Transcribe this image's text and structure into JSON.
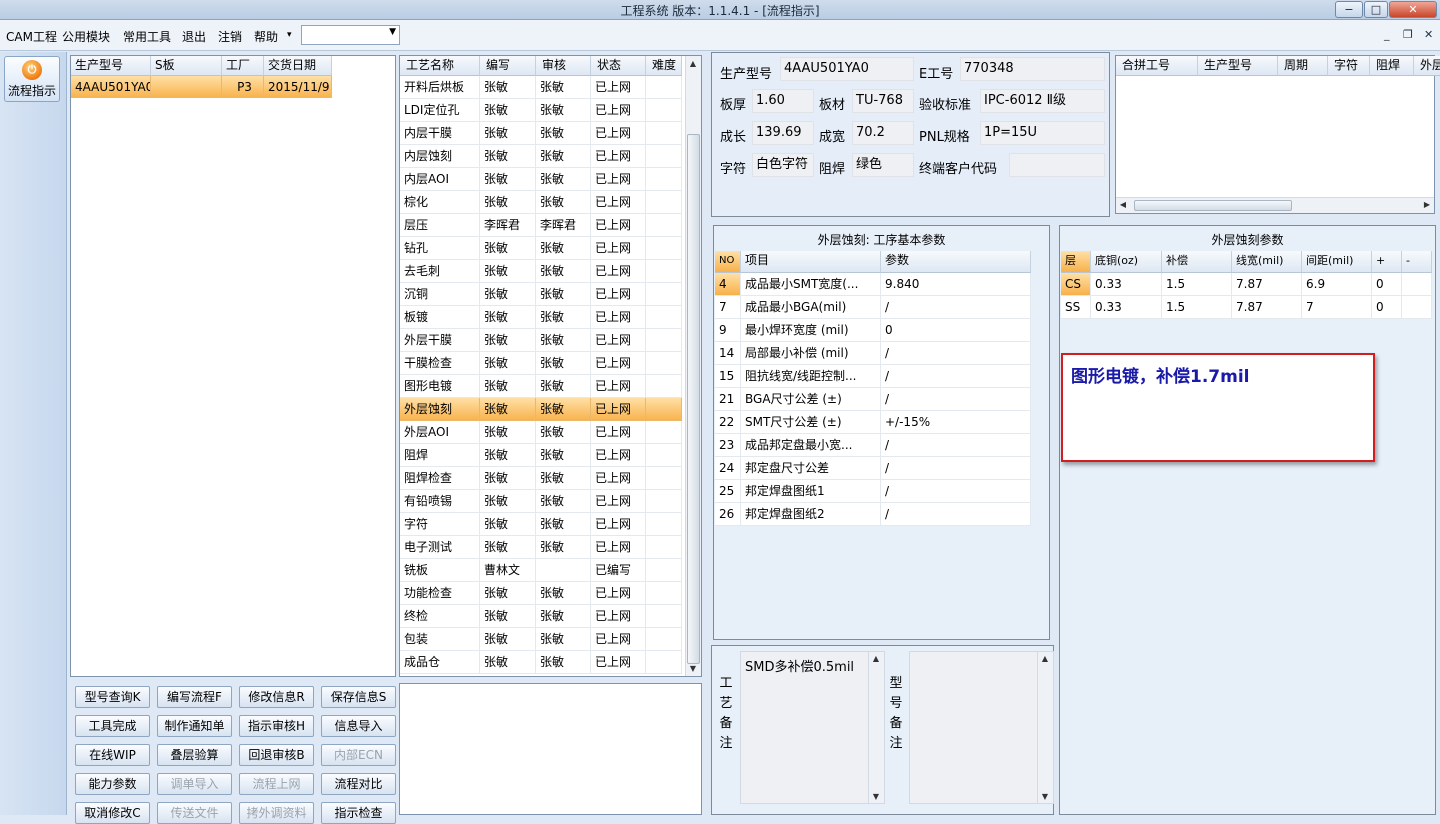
{
  "window": {
    "title": "工程系统   版本：1.1.4.1 - [流程指示]",
    "min": "−",
    "max": "□",
    "close": "✕"
  },
  "menu": {
    "items": [
      "CAM工程",
      "公用模块",
      "常用工具",
      "退出",
      "注销",
      "帮助"
    ],
    "help_arrow": "▾",
    "combo_value": "",
    "mdi": [
      "_",
      "❐",
      "✕"
    ]
  },
  "nav": {
    "flow_button": "流程指示"
  },
  "orders": {
    "columns": [
      "生产型号",
      "S板",
      "工厂",
      "交货日期"
    ],
    "rows": [
      [
        "4AAU501YA0",
        "",
        "P3",
        "2015/11/9"
      ]
    ]
  },
  "process": {
    "columns": [
      "工艺名称",
      "编写",
      "审核",
      "状态",
      "难度"
    ],
    "selected_index": 14,
    "rows": [
      [
        "开料后烘板",
        "张敏",
        "张敏",
        "已上网",
        ""
      ],
      [
        "LDI定位孔",
        "张敏",
        "张敏",
        "已上网",
        ""
      ],
      [
        "内层干膜",
        "张敏",
        "张敏",
        "已上网",
        ""
      ],
      [
        "内层蚀刻",
        "张敏",
        "张敏",
        "已上网",
        ""
      ],
      [
        "内层AOI",
        "张敏",
        "张敏",
        "已上网",
        ""
      ],
      [
        "棕化",
        "张敏",
        "张敏",
        "已上网",
        ""
      ],
      [
        "层压",
        "李晖君",
        "李晖君",
        "已上网",
        ""
      ],
      [
        "钻孔",
        "张敏",
        "张敏",
        "已上网",
        ""
      ],
      [
        "去毛刺",
        "张敏",
        "张敏",
        "已上网",
        ""
      ],
      [
        "沉铜",
        "张敏",
        "张敏",
        "已上网",
        ""
      ],
      [
        "板镀",
        "张敏",
        "张敏",
        "已上网",
        ""
      ],
      [
        "外层干膜",
        "张敏",
        "张敏",
        "已上网",
        ""
      ],
      [
        "干膜检查",
        "张敏",
        "张敏",
        "已上网",
        ""
      ],
      [
        "图形电镀",
        "张敏",
        "张敏",
        "已上网",
        ""
      ],
      [
        "外层蚀刻",
        "张敏",
        "张敏",
        "已上网",
        ""
      ],
      [
        "外层AOI",
        "张敏",
        "张敏",
        "已上网",
        ""
      ],
      [
        "阻焊",
        "张敏",
        "张敏",
        "已上网",
        ""
      ],
      [
        "阻焊检查",
        "张敏",
        "张敏",
        "已上网",
        ""
      ],
      [
        "有铅喷锡",
        "张敏",
        "张敏",
        "已上网",
        ""
      ],
      [
        "字符",
        "张敏",
        "张敏",
        "已上网",
        ""
      ],
      [
        "电子测试",
        "张敏",
        "张敏",
        "已上网",
        ""
      ],
      [
        "铣板",
        "曹林文",
        "",
        "已编写",
        ""
      ],
      [
        "功能检查",
        "张敏",
        "张敏",
        "已上网",
        ""
      ],
      [
        "终检",
        "张敏",
        "张敏",
        "已上网",
        ""
      ],
      [
        "包装",
        "张敏",
        "张敏",
        "已上网",
        ""
      ],
      [
        "成品仓",
        "张敏",
        "张敏",
        "已上网",
        ""
      ]
    ]
  },
  "buttons": [
    [
      "型号查询K",
      "编写流程F",
      "修改信息R",
      "保存信息S"
    ],
    [
      "工具完成",
      "制作通知单",
      "指示审核H",
      "信息导入"
    ],
    [
      "在线WIP",
      "叠层验算",
      "回退审核B",
      "内部ECN"
    ],
    [
      "能力参数",
      "调单导入",
      "流程上网",
      "流程对比"
    ],
    [
      "取消修改C",
      "传送文件",
      "拷外调资料",
      "指示检查"
    ]
  ],
  "buttons_disabled": [
    "内部ECN",
    "调单导入",
    "流程上网",
    "传送文件",
    "拷外调资料"
  ],
  "info": {
    "model_label": "生产型号",
    "model": "4AAU501YA0",
    "e_label": "E工号",
    "e_no": "770348",
    "thick_label": "板厚",
    "thick": "1.60",
    "mat_label": "板材",
    "mat": "TU-768",
    "std_label": "验收标准",
    "std": "IPC-6012 Ⅱ级",
    "len_label": "成长",
    "len": "139.69",
    "wid_label": "成宽",
    "wid": "70.2",
    "pnl_label": "PNL规格",
    "pnl": "1P=15U",
    "char_label": "字符",
    "char": "白色字符",
    "mask_label": "阻焊",
    "mask": "绿色",
    "cust_label": "终端客户代码",
    "cust": ""
  },
  "merge": {
    "columns": [
      "合拼工号",
      "生产型号",
      "周期",
      "字符",
      "阻焊",
      "外层"
    ]
  },
  "basic_params": {
    "title": "外层蚀刻: 工序基本参数",
    "columns": [
      "NO",
      "项目",
      "参数"
    ],
    "selected_index": 0,
    "rows": [
      [
        "4",
        "成品最小SMT宽度(...",
        "9.840"
      ],
      [
        "7",
        "成品最小BGA(mil)",
        "/"
      ],
      [
        "9",
        "最小焊环宽度 (mil)",
        "0"
      ],
      [
        "14",
        "局部最小补偿 (mil)",
        "/"
      ],
      [
        "15",
        "阻抗线宽/线距控制...",
        "/"
      ],
      [
        "21",
        "BGA尺寸公差 (±)",
        "/"
      ],
      [
        "22",
        "SMT尺寸公差 (±)",
        "+/-15%"
      ],
      [
        "23",
        "成品邦定盘最小宽...",
        "/"
      ],
      [
        "24",
        "邦定盘尺寸公差",
        "/"
      ],
      [
        "25",
        "邦定焊盘图纸1",
        "/"
      ],
      [
        "26",
        "邦定焊盘图纸2",
        "/"
      ]
    ]
  },
  "etch_params": {
    "title": "外层蚀刻参数",
    "columns": [
      "层",
      "底铜(oz)",
      "补偿",
      "线宽(mil)",
      "间距(mil)",
      "+",
      "-"
    ],
    "rows": [
      [
        "CS",
        "0.33",
        "1.5",
        "7.87",
        "6.9",
        "0",
        ""
      ],
      [
        "SS",
        "0.33",
        "1.5",
        "7.87",
        "7",
        "0",
        ""
      ]
    ]
  },
  "note_box": {
    "text": "图形电镀，补偿1.7mil"
  },
  "remarks": {
    "process_label": "工艺备注",
    "process_text": "SMD多补偿0.5mil",
    "model_label": "型号备注",
    "model_text": ""
  },
  "colors": {
    "accent": "#f8b14b",
    "note_border": "#d21e1e",
    "note_text": "#1a1aa8"
  }
}
